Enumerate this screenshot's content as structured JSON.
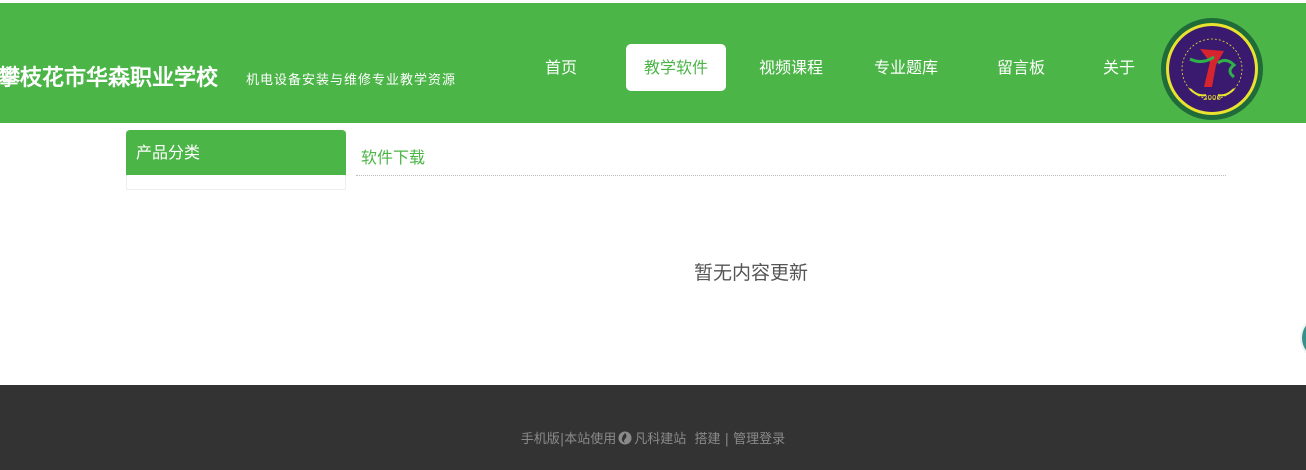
{
  "header": {
    "title": "攀枝花市华森职业学校",
    "subtitle": "机电设备安装与维修专业教学资源",
    "brand_color": "#4cb548"
  },
  "nav": {
    "items": [
      {
        "label": "首页",
        "active": false
      },
      {
        "label": "教学软件",
        "active": true
      },
      {
        "label": "视频课程",
        "active": false
      },
      {
        "label": "专业题库",
        "active": false
      },
      {
        "label": "留言板",
        "active": false
      },
      {
        "label": "关于",
        "active": false
      }
    ]
  },
  "logo": {
    "icon": "school-emblem-icon",
    "year": "2006"
  },
  "sidebar": {
    "heading": "产品分类"
  },
  "content": {
    "title": "软件下载",
    "empty_message": "暂无内容更新"
  },
  "footer": {
    "mobile": "手机版",
    "uses_prefix": "|本站使用",
    "builder": "凡科建站",
    "built": "搭建",
    "separator": "|",
    "admin_login": "管理登录"
  }
}
